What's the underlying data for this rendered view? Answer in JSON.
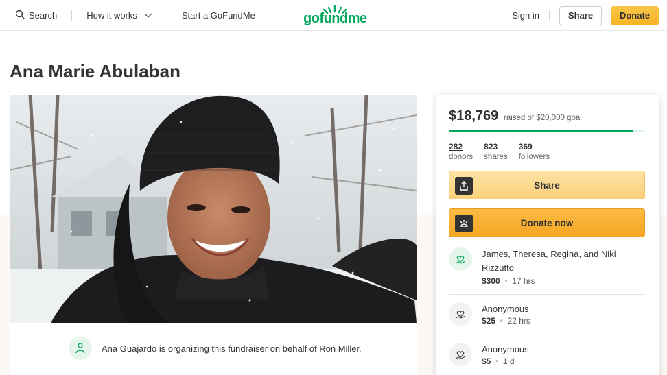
{
  "header": {
    "search_label": "Search",
    "how_it_works_label": "How it works",
    "start_label": "Start a GoFundMe",
    "logo_text": "gofundme",
    "signin_label": "Sign in",
    "share_label": "Share",
    "donate_label": "Donate"
  },
  "campaign": {
    "title": "Ana Marie Abulaban",
    "organizer_text": "Ana Guajardo is organizing this fundraiser on behalf of Ron Miller."
  },
  "progress": {
    "raised": "$18,769",
    "goal_text": "raised of $20,000 goal",
    "fraction": 0.938
  },
  "stats": [
    {
      "value": "282",
      "label": "donors"
    },
    {
      "value": "823",
      "label": "shares"
    },
    {
      "value": "369",
      "label": "followers"
    }
  ],
  "card_buttons": {
    "share_label": "Share",
    "donate_label": "Donate now"
  },
  "donations": [
    {
      "name": "James, Theresa, Regina, and Niki Rizzutto",
      "amount": "$300",
      "time": "17 hrs"
    },
    {
      "name": "Anonymous",
      "amount": "$25",
      "time": "22 hrs"
    },
    {
      "name": "Anonymous",
      "amount": "$5",
      "time": "1 d"
    }
  ],
  "colors": {
    "brand_green": "#02a95c",
    "donate_yellow": "#f6a623"
  }
}
